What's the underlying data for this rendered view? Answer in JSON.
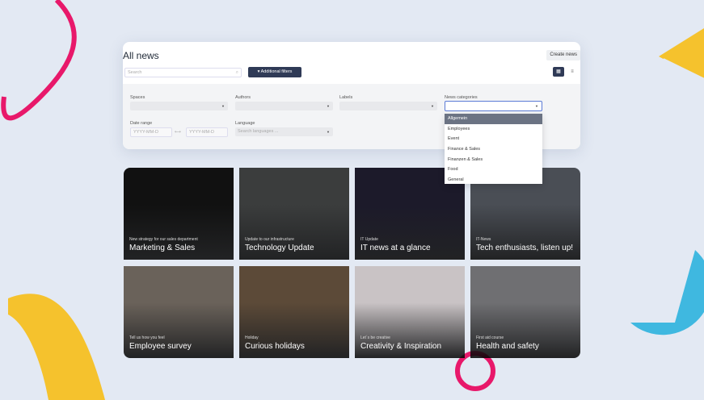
{
  "page": {
    "title": "All news",
    "create_label": "Create news",
    "search_placeholder": "Search",
    "additional_filters": "Additional filters"
  },
  "filters": {
    "spaces": "Spaces",
    "authors": "Authors",
    "labels": "Labels",
    "news_categories": "News categories",
    "date_range": "Date range",
    "date_from_placeholder": "YYYY-MM-D",
    "date_to_placeholder": "YYYY-MM-D",
    "date_sep": "⟷",
    "language": "Language",
    "language_placeholder": "Search languages ..."
  },
  "dropdown": [
    "Allgemein",
    "Employees",
    "Event",
    "Finance & Sales",
    "Finanzen & Sales",
    "Food",
    "General"
  ],
  "cards": [
    {
      "sub": "New strategy for our sales department",
      "title": "Marketing & Sales",
      "bg": "#111"
    },
    {
      "sub": "Update to our infrastructure",
      "title": "Technology Update",
      "bg": "#3b3d3d"
    },
    {
      "sub": "IT Update",
      "title": "IT news at a glance",
      "bg": "#1c1a2a"
    },
    {
      "sub": "IT-News",
      "title": "Tech enthusiasts, listen up!",
      "bg": "#4a4e55"
    },
    {
      "sub": "Tell us how you feel",
      "title": "Employee survey",
      "bg": "#6a625a"
    },
    {
      "sub": "Holiday",
      "title": "Curious holidays",
      "bg": "#5c4a38"
    },
    {
      "sub": "Let´s be creative",
      "title": "Creativity & Inspiration",
      "bg": "#c9c3c5"
    },
    {
      "sub": "First aid course",
      "title": "Health and safety",
      "bg": "#6f6f72"
    }
  ]
}
